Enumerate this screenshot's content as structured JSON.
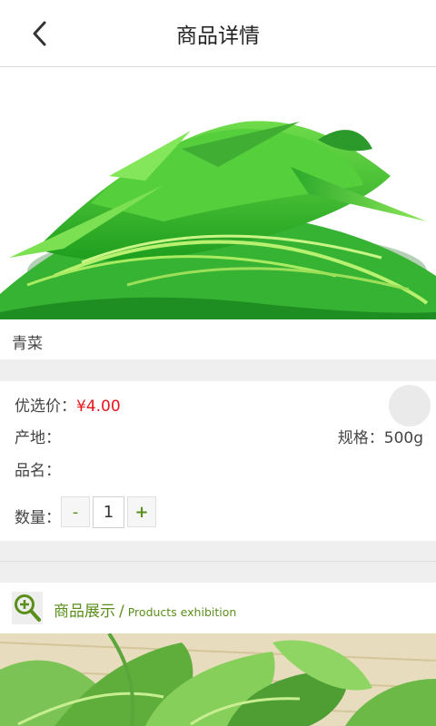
{
  "header": {
    "title": "商品详情"
  },
  "product": {
    "name": "青菜",
    "price_label": "优选价：",
    "price_value": "¥4.00",
    "origin_label": "产地：",
    "spec_label": "规格：500g",
    "title_label": "品名：",
    "quantity_label": "数量：",
    "quantity": "1",
    "minus_label": "-",
    "plus_label": "+"
  },
  "section": {
    "title": "商品展示",
    "divider": "/",
    "subtitle": "Products exhibition"
  },
  "icons": {
    "back": "chevron-left-icon",
    "zoom": "zoom-in-icon"
  },
  "colors": {
    "accent": "#5b8f1c",
    "price": "#e8161b",
    "separator": "#efefef"
  }
}
